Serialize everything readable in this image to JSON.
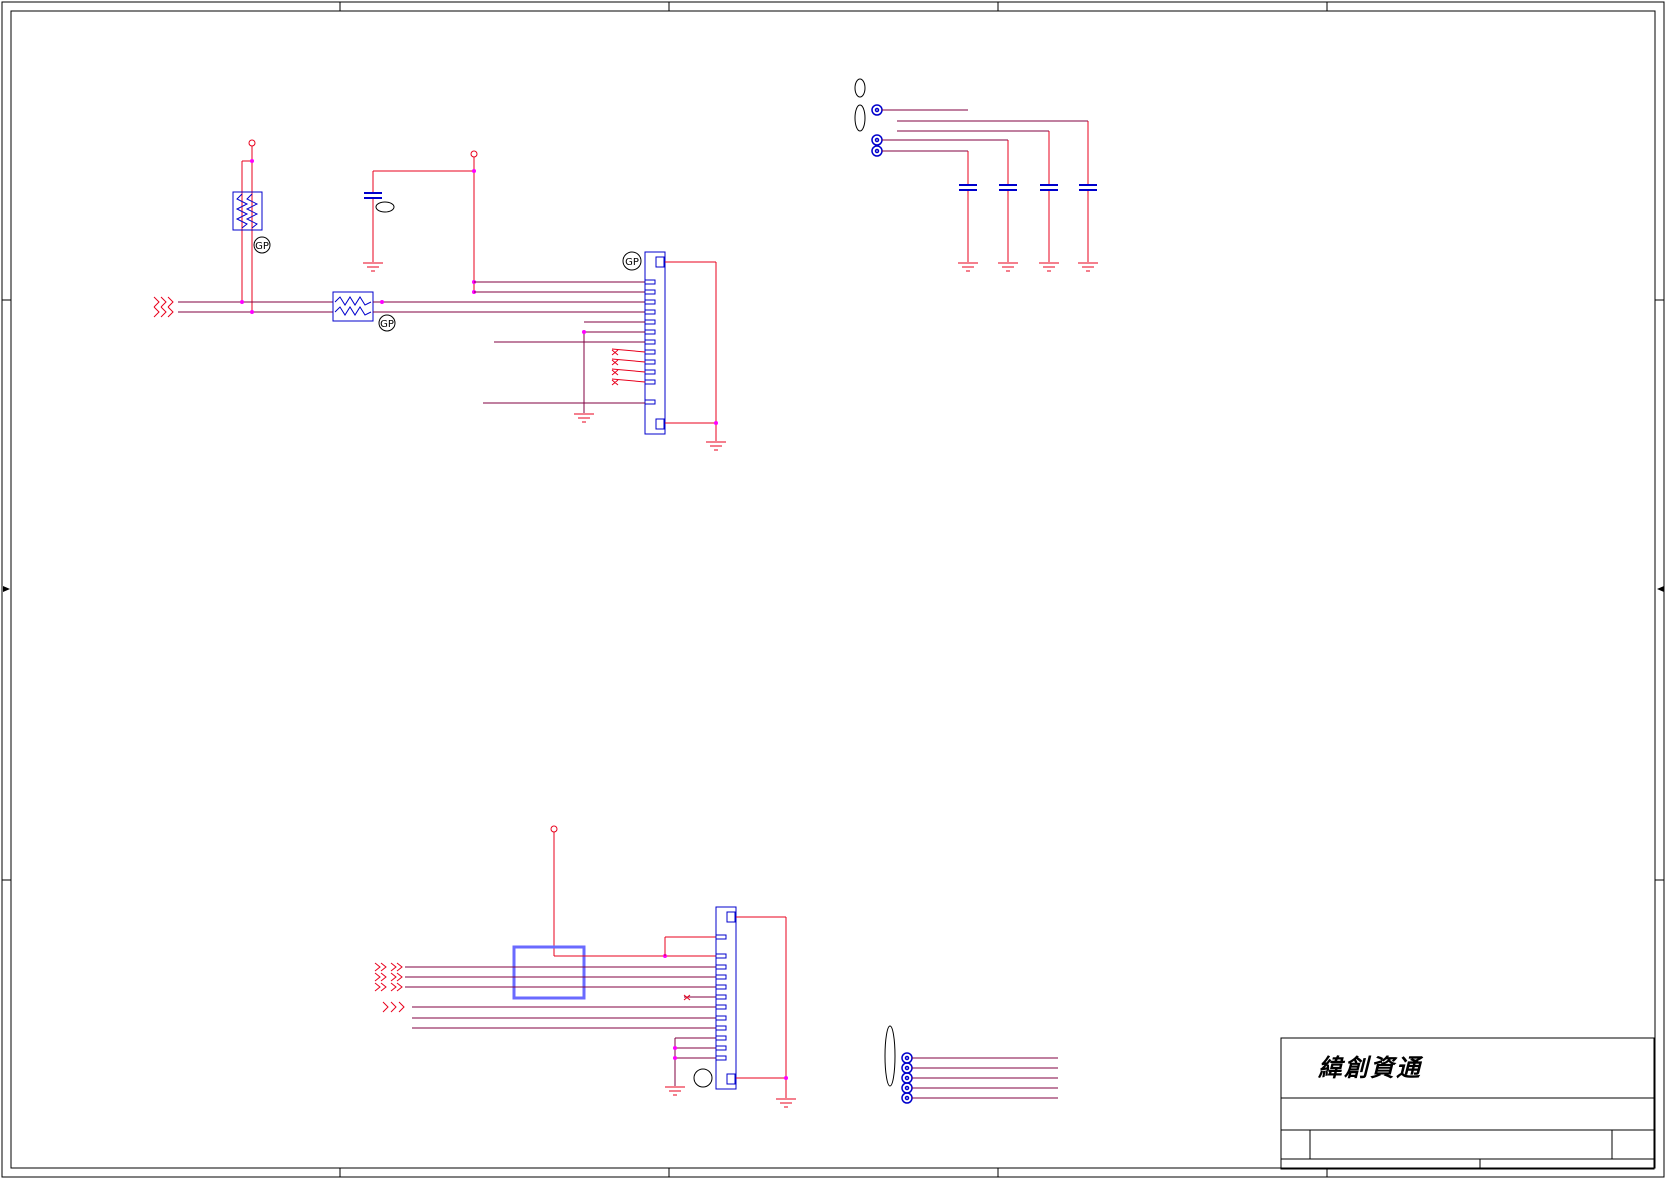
{
  "title_block": {
    "company_name": "緯創資通"
  },
  "colors": {
    "wire": "#e8001c",
    "net_line": "#800040",
    "component": "#0000cc",
    "junction": "#ff00ff",
    "highlight_box": "#6a6aff",
    "frame": "#000000"
  },
  "annotations": {
    "gp_tags": [
      "GP",
      "GP",
      "GP"
    ]
  },
  "icons": {
    "connector": "connector-icon",
    "thermistor": "ptc-fuse-icon",
    "capacitor": "capacitor-icon",
    "ground": "ground-icon",
    "test_point": "test-point-icon",
    "no_connect": "no-connect-icon",
    "off_page": "off-page-arrow-icon"
  }
}
